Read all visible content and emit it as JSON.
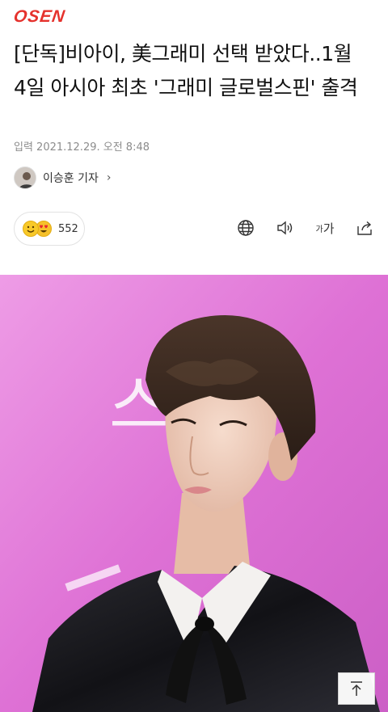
{
  "header": {
    "logo_text": "OSEN"
  },
  "article": {
    "headline": "[단독]비아이, 美그래미 선택 받았다..1월 4일 아시아 최초 '그래미 글로벌스핀' 출격",
    "published": "입력 2021.12.29. 오전 8:48",
    "reporter": "이승훈 기자",
    "reporter_chevron": "›"
  },
  "reactions": {
    "count": "552"
  },
  "toolbar": {
    "font_size_small": "가",
    "font_size_large": "가",
    "icons": [
      "globe-icon",
      "speaker-icon",
      "font-size-icon",
      "share-icon"
    ]
  },
  "photo": {
    "background_sign_text": "스"
  },
  "colors": {
    "brand": "#e5322d",
    "photo_bg": "#df6fd4",
    "meta": "#8c8c8c"
  }
}
